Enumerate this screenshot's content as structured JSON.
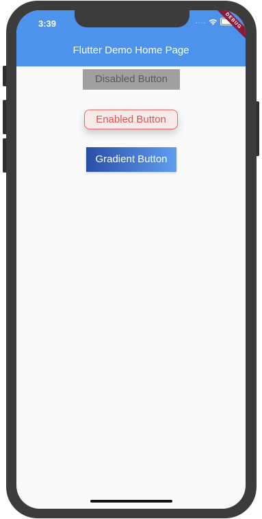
{
  "status_bar": {
    "time": "3:39",
    "signal_dots": "....",
    "debug_label": "DEBUG"
  },
  "app_bar": {
    "title": "Flutter Demo Home Page",
    "color": "#4d93ec"
  },
  "buttons": {
    "disabled": {
      "label": "Disabled Button"
    },
    "enabled": {
      "label": "Enabled Button",
      "color": "#d9534f"
    },
    "gradient": {
      "label": "Gradient Button",
      "gradient_start": "#2a4ea7",
      "gradient_end": "#5f9ef0"
    }
  },
  "icons": {
    "wifi": "wifi-icon",
    "battery": "battery-icon"
  }
}
